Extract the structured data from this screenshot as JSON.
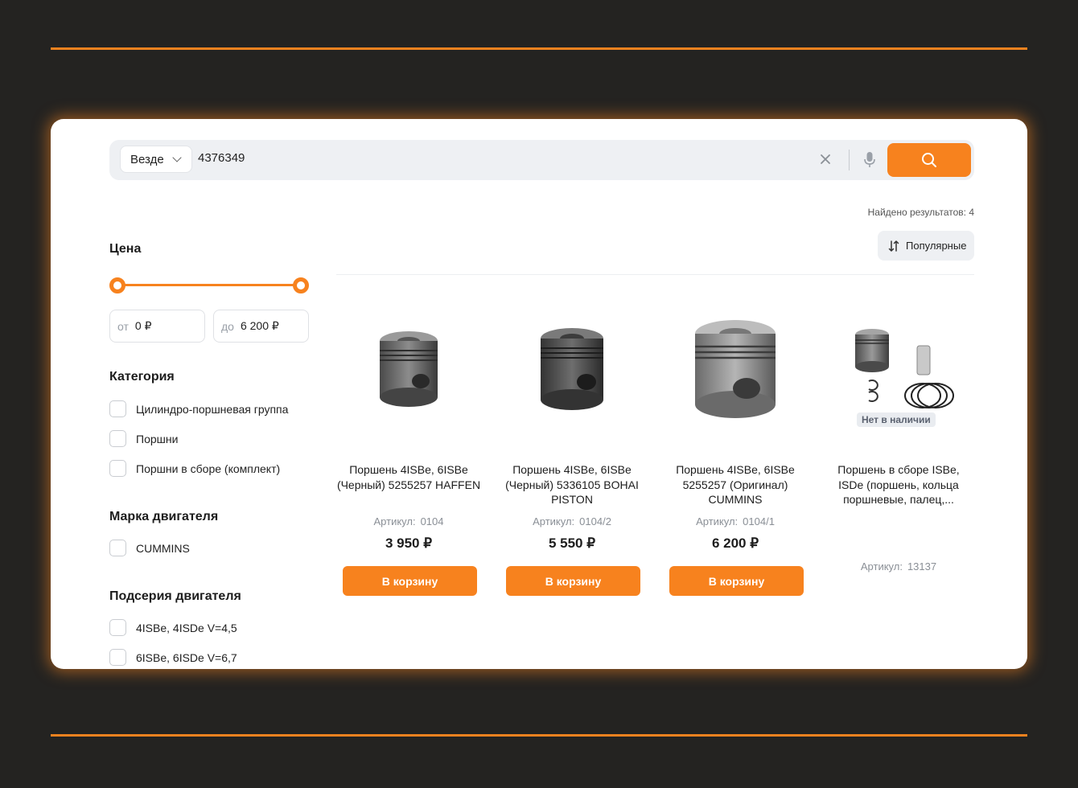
{
  "search": {
    "scope_label": "Везде",
    "query": "4376349",
    "found_label": "Найдено результатов: 4",
    "sort_label": "Популярные"
  },
  "filters": {
    "price": {
      "title": "Цена",
      "from_prefix": "от",
      "from_value": "0 ₽",
      "to_prefix": "до",
      "to_value": "6 200 ₽"
    },
    "category": {
      "title": "Категория",
      "options": [
        "Цилиндро-поршневая группа",
        "Поршни",
        "Поршни в сборе (комплект)"
      ]
    },
    "engine_brand": {
      "title": "Марка двигателя",
      "options": [
        "CUMMINS"
      ]
    },
    "engine_subseries": {
      "title": "Подсерия двигателя",
      "options": [
        "4ISBe, 4ISDe V=4,5",
        "6ISBe, 6ISDe V=6,7"
      ]
    }
  },
  "products": [
    {
      "name": "Поршень 4ISBe, 6ISBe (Черный) 5255257 HAFFEN",
      "sku_label": "Артикул:",
      "sku": "0104",
      "price": "3 950 ₽",
      "cart_label": "В корзину"
    },
    {
      "name": "Поршень 4ISBe, 6ISBe (Черный) 5336105 BOHAI PISTON",
      "sku_label": "Артикул:",
      "sku": "0104/2",
      "price": "5 550 ₽",
      "cart_label": "В корзину"
    },
    {
      "name": "Поршень 4ISBe, 6ISBe 5255257 (Оригинал) CUMMINS",
      "sku_label": "Артикул:",
      "sku": "0104/1",
      "price": "6 200 ₽",
      "cart_label": "В корзину"
    },
    {
      "name": "Поршень в сборе ISBe, ISDe (поршень, кольца поршневые, палец,...",
      "sku_label": "Артикул:",
      "sku": "13137",
      "badge": "Нет в наличии"
    }
  ],
  "colors": {
    "accent": "#f7821e",
    "background": "#242321",
    "card": "#ffffff"
  }
}
